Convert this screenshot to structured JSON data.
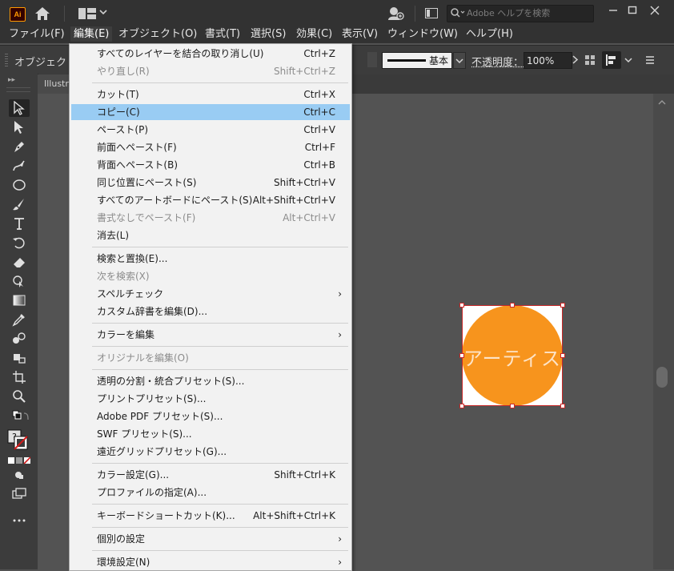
{
  "titlebar": {
    "app_logo": "Ai",
    "search_placeholder": "Adobe ヘルプを検索"
  },
  "menubar": [
    "ファイル(F)",
    "編集(E)",
    "オブジェクト(O)",
    "書式(T)",
    "選択(S)",
    "効果(C)",
    "表示(V)",
    "ウィンドウ(W)",
    "ヘルプ(H)"
  ],
  "controlbar": {
    "object_label": "オブジェクト",
    "stroke_style": "基本",
    "opacity_label": "不透明度：",
    "opacity_value": "100%"
  },
  "document": {
    "tab_label": "Illustr",
    "circle_text": "アーティス",
    "circle_color": "#f7941d"
  },
  "edit_menu": {
    "items": [
      {
        "label": "すべてのレイヤーを結合の取り消し(U)",
        "shortcut": "Ctrl+Z"
      },
      {
        "label": "やり直し(R)",
        "shortcut": "Shift+Ctrl+Z"
      },
      {
        "label": "カット(T)",
        "shortcut": "Ctrl+X"
      },
      {
        "label": "コピー(C)",
        "shortcut": "Ctrl+C"
      },
      {
        "label": "ペースト(P)",
        "shortcut": "Ctrl+V"
      },
      {
        "label": "前面へペースト(F)",
        "shortcut": "Ctrl+F"
      },
      {
        "label": "背面へペースト(B)",
        "shortcut": "Ctrl+B"
      },
      {
        "label": "同じ位置にペースト(S)",
        "shortcut": "Shift+Ctrl+V"
      },
      {
        "label": "すべてのアートボードにペースト(S)",
        "shortcut": "Alt+Shift+Ctrl+V"
      },
      {
        "label": "書式なしでペースト(F)",
        "shortcut": "Alt+Ctrl+V"
      },
      {
        "label": "消去(L)",
        "shortcut": ""
      },
      {
        "label": "検索と置換(E)...",
        "shortcut": ""
      },
      {
        "label": "次を検索(X)",
        "shortcut": ""
      },
      {
        "label": "スペルチェック",
        "shortcut": ""
      },
      {
        "label": "カスタム辞書を編集(D)...",
        "shortcut": ""
      },
      {
        "label": "カラーを編集",
        "shortcut": ""
      },
      {
        "label": "オリジナルを編集(O)",
        "shortcut": ""
      },
      {
        "label": "透明の分割・統合プリセット(S)...",
        "shortcut": ""
      },
      {
        "label": "プリントプリセット(S)...",
        "shortcut": ""
      },
      {
        "label": "Adobe PDF プリセット(S)...",
        "shortcut": ""
      },
      {
        "label": "SWF プリセット(S)...",
        "shortcut": ""
      },
      {
        "label": "遠近グリッドプリセット(G)...",
        "shortcut": ""
      },
      {
        "label": "カラー設定(G)...",
        "shortcut": "Shift+Ctrl+K"
      },
      {
        "label": "プロファイルの指定(A)...",
        "shortcut": ""
      },
      {
        "label": "キーボードショートカット(K)...",
        "shortcut": "Alt+Shift+Ctrl+K"
      },
      {
        "label": "個別の設定",
        "shortcut": ""
      },
      {
        "label": "環境設定(N)",
        "shortcut": ""
      }
    ]
  }
}
